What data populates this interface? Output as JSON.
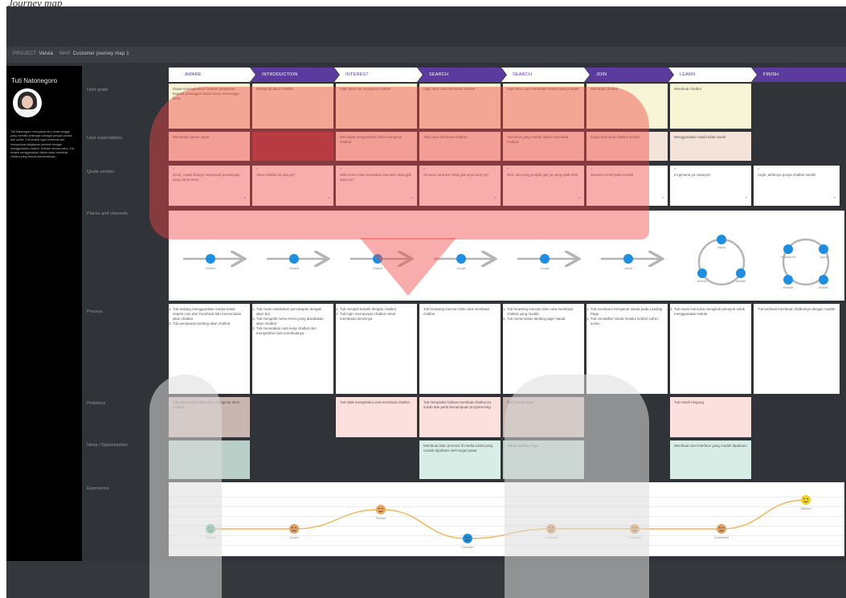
{
  "title": "Journey map",
  "project": {
    "project_label": "PROJECT",
    "project_name": "Vatula",
    "map_label": "MAP",
    "map_name": "Customer journey map 1"
  },
  "persona": {
    "name": "Tuti Natonegoro",
    "description": "Tuti Natonegoro merupakan ibu rumah tangga yang memiliki pekerjaan sebagai penjual produk dari online. Tuti tertarik ingin berbisnis dan memperluas jangkauan pembeli dengan menggunakan chatbot. Setelah mencari tahu, Tuti tertarik menggunakan Vatula untuk membuat chatbot yang sesuai kebutuhannya."
  },
  "stages": [
    "AWARE",
    "INTRODUCTION",
    "INTEREST",
    "SEARCH",
    "SEARCH",
    "JOIN",
    "LEARN",
    "FINISH"
  ],
  "rows": {
    "user_goals": "User goals",
    "expectations": "User expectations",
    "quote": "Quote section",
    "places": "Places and channels",
    "process": "Process",
    "problems": "Problems",
    "ideas": "Ideas / Opportunities",
    "experience": "Experience"
  },
  "goals": [
    "Dapat meningkatkan kualitas pelayanan kepada pelanggan tanpa harus menunggu lama",
    "Mengenal akun chatbot",
    "Ingin lebih tau mengenai chatbot",
    "Ingin tahu cara membuat chatbot",
    "Ingin tahu cara membuat chatbot yang mudah",
    "Membuat chatbot",
    "Membuat chatbot",
    ""
  ],
  "expectations": [
    "Membalas pesan cepat",
    "",
    "Mendapat pengetahuan lebih mengenai chatbot",
    "Tahu cara membuat chatbot",
    "Ada situs yang mudah dalam membuat chatbot",
    "Dapat membuat chatbot sendiri",
    "Menggunakan vatula tidak susah",
    ""
  ],
  "quotes": [
    "Duuh, capek banget menjawab pertanyaan yang sama terus",
    "Akun chatbot ini apa ya?",
    "Wah keren bisa membalas otomatis. Bisa gak saya ya?",
    "Gimana caranya? Bisa gak saya buat ya?",
    "Duh, ada yang mudah gak ya yang tidak ribet",
    "Wowww ini ternyata mudah",
    "Ini gimana ya caranya?",
    "Asyik, akhirnya punya chatbot sendiri"
  ],
  "channels": [
    "Chatbot",
    "Chatbot",
    "Chatbot",
    "Google",
    "Google",
    "Laptop"
  ],
  "channels_cycle_7": [
    "Laptop",
    "Website",
    "Website"
  ],
  "channels_cycle_8": [
    "Smartphone",
    "Laptop",
    "Website",
    "Website"
  ],
  "process": [
    [
      "Tuti sedang menggunakan media sosial seperti Line dan Facebook lalu menemukan akun chatbot",
      "Tuti penasaran tentang akun chatbot"
    ],
    [
      "Tuti mulai melakukan percakapan dengan akun bot",
      "Tuti mengetik menu-menu yang disediakan akun chatbot",
      "Tuti merasakan cara kerja chatbot dan mengetahui cara membuatnya"
    ],
    [
      "Tuti menjadi tertarik dengan chatbot",
      "Tuti ingin mempunyai chatbot untuk membantu bisnisnya"
    ],
    [
      "Tuti browsing mencari tahu cara membuat chatbot"
    ],
    [
      "Tuti browsing mencari tahu cara membuat chatbot yang mudah",
      "Tuti menemukan landing page Vatula"
    ],
    [
      "Tuti membaca mengenai Vatula pada Landing Page",
      "Tuti mendaftar Vatula melalui tombol call to action"
    ],
    [
      "Tuti mulai mencoba mengikuti petunjuk untuk menggunakan Vatula"
    ],
    [
      "Tuti berhasil membuat chatbotnya dengan mudah"
    ]
  ],
  "problems": [
    "Tuti sama sekali tidak tahu mengenai akun chatbot",
    "",
    "Tuti tidak mengetahui cara membuat chatbot",
    "Tuti menyadari bahwa membuat chatbot itu susah dan perlu kemampuan programming",
    "Tuti kebingungan",
    "",
    "Tuti masih bingung",
    ""
  ],
  "ideas": [
    "",
    "",
    "",
    "Membuat iklan promosi di media sosial yang mudah dipahami oleh target pasar",
    "Vatula landing Page",
    "",
    "Membuat user interface yang mudah dipahami",
    ""
  ],
  "experience": {
    "labels": [
      "Curious",
      "Curious",
      "Pleased",
      "Confused",
      "Confused",
      "Confused",
      "Understand",
      "Satisfied"
    ],
    "values": [
      -1,
      -1,
      1,
      -2,
      -1,
      -1,
      -1,
      2
    ]
  },
  "colors": {
    "board": "#303439",
    "sidebar": "#000000",
    "stage_accent": "#5b3c9e",
    "channel_blue": "#1e8fe0",
    "overlay_red": "#f04848"
  },
  "icons": {
    "channel": "message-bubble-icon",
    "google": "google-icon",
    "laptop": "laptop-icon",
    "arrow": "arrow-right-icon",
    "emoji": "emoji-face-icon"
  }
}
